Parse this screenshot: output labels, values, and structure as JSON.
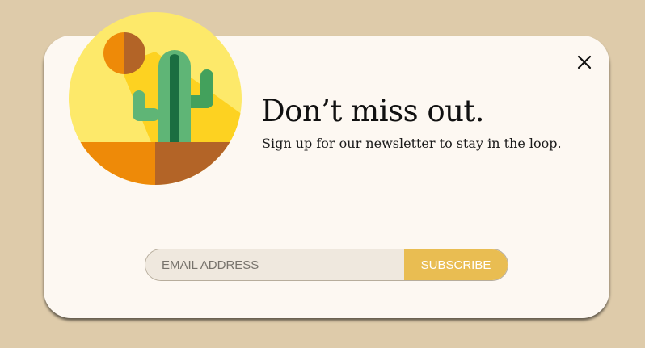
{
  "modal": {
    "illustration_icon": "cactus-desert-sun-illustration",
    "close_icon": "close-icon",
    "headline": "Don’t miss out.",
    "subline": "Sign up for our newsletter to stay in the loop."
  },
  "form": {
    "email_placeholder": "EMAIL ADDRESS",
    "email_value": "",
    "subscribe_label": "SUBSCRIBE"
  },
  "colors": {
    "page_background": "#decbaa",
    "modal_background": "#fdf8f2",
    "accent": "#e9bd52",
    "input_background": "#efe8de"
  }
}
